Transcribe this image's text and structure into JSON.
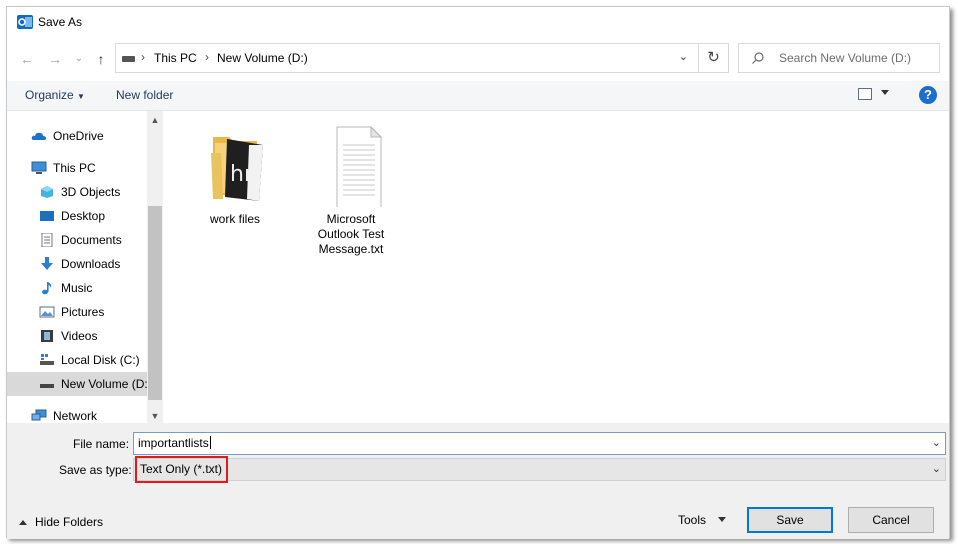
{
  "window": {
    "title": "Save As",
    "app_icon": "outlook-icon"
  },
  "address": {
    "path": [
      "This PC",
      "New Volume (D:)"
    ],
    "search_placeholder": "Search New Volume (D:)"
  },
  "commands": {
    "organize": "Organize",
    "new_folder": "New folder",
    "help": "?"
  },
  "sidebar": {
    "items": [
      {
        "label": "OneDrive",
        "icon": "onedrive-icon"
      },
      {
        "label": "This PC",
        "icon": "this-pc-icon"
      },
      {
        "label": "3D Objects",
        "icon": "3d-objects-icon"
      },
      {
        "label": "Desktop",
        "icon": "desktop-icon"
      },
      {
        "label": "Documents",
        "icon": "documents-icon"
      },
      {
        "label": "Downloads",
        "icon": "downloads-icon"
      },
      {
        "label": "Music",
        "icon": "music-icon"
      },
      {
        "label": "Pictures",
        "icon": "pictures-icon"
      },
      {
        "label": "Videos",
        "icon": "videos-icon"
      },
      {
        "label": "Local Disk (C:)",
        "icon": "local-disk-icon"
      },
      {
        "label": "New Volume (D:)",
        "icon": "drive-icon",
        "selected": true
      },
      {
        "label": "Network",
        "icon": "network-icon"
      }
    ]
  },
  "files": [
    {
      "name": "work files",
      "type": "folder",
      "icon": "folder-icon"
    },
    {
      "name": "Microsoft Outlook Test Message.txt",
      "name_lines": [
        "Microsoft",
        "Outlook Test",
        "Message.txt"
      ],
      "type": "text",
      "icon": "text-file-icon"
    }
  ],
  "form": {
    "file_name_label": "File name:",
    "file_name_value": "importantlists",
    "save_type_label": "Save as type:",
    "save_type_value": "Text Only (*.txt)"
  },
  "footer": {
    "hide_folders": "Hide Folders",
    "tools": "Tools",
    "save": "Save",
    "cancel": "Cancel"
  },
  "colors": {
    "highlight_box": "#e01b1b",
    "help_blue": "#1b6ed0",
    "selected_row": "#d9d9d9"
  }
}
